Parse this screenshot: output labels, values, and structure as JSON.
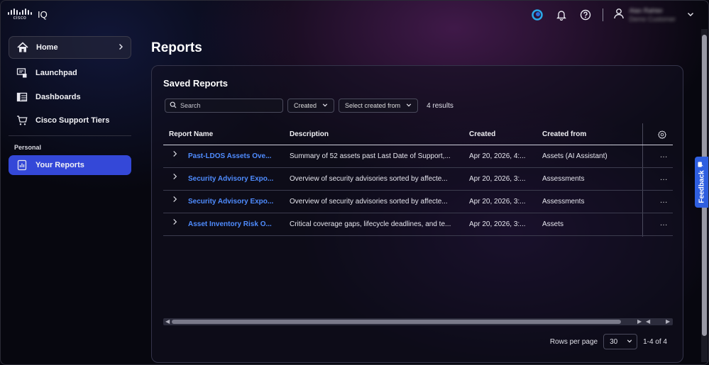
{
  "app": {
    "brand": "cisco",
    "product": "IQ"
  },
  "header": {
    "user_name": "Alan Rahter",
    "user_org": "Demo Customer"
  },
  "sidebar": {
    "items": [
      {
        "label": "Home",
        "icon": "home-icon"
      },
      {
        "label": "Launchpad",
        "icon": "launchpad-icon"
      },
      {
        "label": "Dashboards",
        "icon": "dashboards-icon"
      },
      {
        "label": "Cisco Support Tiers",
        "icon": "cart-icon"
      }
    ],
    "section_label": "Personal",
    "personal_items": [
      {
        "label": "Your Reports",
        "icon": "report-icon",
        "active": true
      }
    ]
  },
  "main": {
    "page_title": "Reports",
    "card_title": "Saved Reports",
    "search_placeholder": "Search",
    "filter_created": "Created",
    "filter_created_from": "Select created from",
    "results_count": "4 results",
    "columns": [
      "Report Name",
      "Description",
      "Created",
      "Created from"
    ],
    "rows": [
      {
        "name": "Past-LDOS Assets Ove...",
        "description": "Summary of 52 assets past Last Date of Support,...",
        "created": "Apr 20, 2026, 4:...",
        "created_from": "Assets (AI Assistant)"
      },
      {
        "name": "Security Advisory Expo...",
        "description": "Overview of security advisories sorted by affecte...",
        "created": "Apr 20, 2026, 3:...",
        "created_from": "Assessments"
      },
      {
        "name": "Security Advisory Expo...",
        "description": "Overview of security advisories sorted by affecte...",
        "created": "Apr 20, 2026, 3:...",
        "created_from": "Assessments"
      },
      {
        "name": "Asset Inventory Risk O...",
        "description": "Critical coverage gaps, lifecycle deadlines, and te...",
        "created": "Apr 20, 2026, 3:...",
        "created_from": "Assets"
      }
    ],
    "actions_label": "...",
    "rows_per_page_label": "Rows per page",
    "rows_per_page_value": "30",
    "range_label": "1-4 of 4"
  },
  "feedback_label": "Feedback",
  "colors": {
    "accent": "#3448d8",
    "link": "#4f8cff",
    "feedback": "#2f5fe0"
  }
}
